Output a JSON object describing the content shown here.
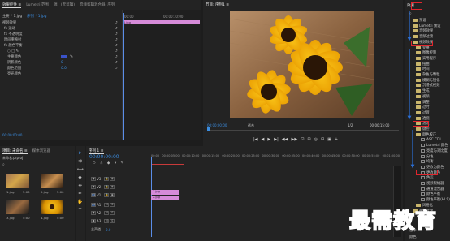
{
  "effect_controls": {
    "tabs": [
      "效果控件 ≡",
      "Lumetri 范围",
      "源：(无剪辑)",
      "音频剪辑混合器: 序列"
    ],
    "clip_header": "主要 * 1.jpg",
    "clip_link": "序列 * 1.jpg",
    "section_video": "视频效果",
    "rows": [
      "fx 运动",
      "fx 不透明度",
      "时间重映射",
      "fx 颜色平衡"
    ],
    "sub_rows": [
      "○ □ ✎",
      "主要颜色",
      "阴影颜色",
      "颜色范围",
      "亮光颜色"
    ],
    "values": [
      "",
      "",
      "0",
      "0.0",
      ""
    ],
    "ruler_start": "00:00",
    "ruler_mid": "00:00:10:00",
    "clip_name": "1.jpg",
    "timecode": "00:00:00:00"
  },
  "program": {
    "title": "节目: 序列1 ≡",
    "timecode_left": "00:00:00:00",
    "fit": "适合",
    "ratio": "1/2",
    "timecode_right": "00:00:15:00"
  },
  "transport": [
    "|◀",
    "◀",
    "▶",
    "▶|",
    "◀◀",
    "▶▶",
    "⊡",
    "⊞",
    "◎",
    "⊟",
    "▣",
    "+"
  ],
  "project": {
    "tabs": [
      "项目: 未命名 ≡",
      "媒体浏览器"
    ],
    "bin_name": "未命名.prproj",
    "thumbnails": [
      {
        "name": "1.jpg",
        "duration": "5:00"
      },
      {
        "name": "2.jpg",
        "duration": "5:00"
      },
      {
        "name": "3.jpg",
        "duration": "5:00"
      },
      {
        "name": "4.jpg",
        "duration": "5:00"
      }
    ]
  },
  "timeline": {
    "tab": "序列 1 ≡",
    "timecode": "00:00:00:00",
    "ruler_labels": [
      "00:00",
      "00:00:05:00",
      "00:00:10:00",
      "00:00:15:00",
      "00:00:20:00",
      "00:00:25:00",
      "00:00:30:00",
      "00:00:35:00",
      "00:00:40:00",
      "00:00:45:00",
      "00:00:50:00",
      "00:00:55:00",
      "00:01:00:00"
    ],
    "tracks": [
      "V3",
      "V2",
      "V1",
      "A1",
      "A2",
      "A3",
      "主声道"
    ],
    "master_value": "0.0",
    "clips": [
      {
        "name": "1.jpg",
        "track": "V2"
      },
      {
        "name": "2.jpg",
        "track": "V1"
      }
    ]
  },
  "effects": {
    "tab": "效果",
    "items": [
      {
        "label": "预设",
        "kind": "folder"
      },
      {
        "label": "Lumetri 预设",
        "kind": "folder"
      },
      {
        "label": "音频效果",
        "kind": "folder"
      },
      {
        "label": "音频过渡",
        "kind": "folder"
      },
      {
        "label": "视频效果",
        "kind": "folder"
      },
      {
        "label": "变换",
        "kind": "folder"
      },
      {
        "label": "图像控制",
        "kind": "folder"
      },
      {
        "label": "实用程序",
        "kind": "folder"
      },
      {
        "label": "扭曲",
        "kind": "folder"
      },
      {
        "label": "时间",
        "kind": "folder"
      },
      {
        "label": "杂色与颗粒",
        "kind": "folder"
      },
      {
        "label": "模糊与锐化",
        "kind": "folder"
      },
      {
        "label": "沉浸式视频",
        "kind": "folder"
      },
      {
        "label": "生成",
        "kind": "folder"
      },
      {
        "label": "视频",
        "kind": "folder"
      },
      {
        "label": "调整",
        "kind": "folder"
      },
      {
        "label": "过时",
        "kind": "folder"
      },
      {
        "label": "过渡",
        "kind": "folder"
      },
      {
        "label": "透视",
        "kind": "folder"
      },
      {
        "label": "通道",
        "kind": "folder"
      },
      {
        "label": "键控",
        "kind": "folder"
      },
      {
        "label": "颜色校正",
        "kind": "folder"
      },
      {
        "label": "ASC CDL",
        "kind": "fx"
      },
      {
        "label": "Lumetri 颜色",
        "kind": "fx"
      },
      {
        "label": "亮度与对比度",
        "kind": "fx"
      },
      {
        "label": "分色",
        "kind": "fx"
      },
      {
        "label": "均衡",
        "kind": "fx"
      },
      {
        "label": "更改为颜色",
        "kind": "fx"
      },
      {
        "label": "更改颜色",
        "kind": "fx"
      },
      {
        "label": "色彩",
        "kind": "fx"
      },
      {
        "label": "视频限幅器",
        "kind": "fx"
      },
      {
        "label": "通道混合器",
        "kind": "fx"
      },
      {
        "label": "颜色平衡",
        "kind": "fx"
      },
      {
        "label": "颜色平衡(HLS)",
        "kind": "fx"
      },
      {
        "label": "风格化",
        "kind": "folder"
      },
      {
        "label": "视频过渡",
        "kind": "folder"
      }
    ],
    "bottom": [
      "基本",
      "颜色"
    ]
  },
  "watermark": "最需教育"
}
